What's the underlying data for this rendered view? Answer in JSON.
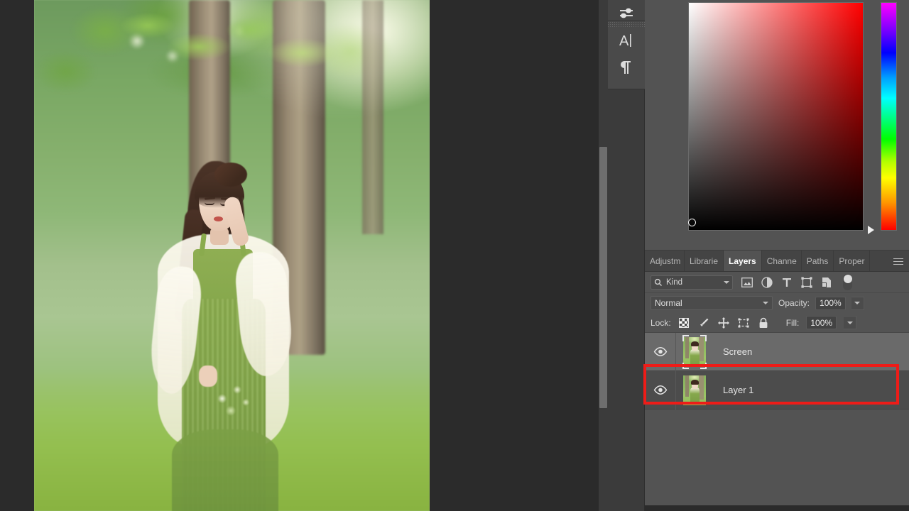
{
  "app": {
    "name": "Adobe Photoshop",
    "canvas_background": "#2b2b2b",
    "panel_background": "#535353"
  },
  "canvas": {
    "document_description": "Photo of a woman in a green dress and white cardigan holding flowers beside a lake with blurred trees and grass",
    "scrollbar": {
      "name": "vertical-scrollbar"
    }
  },
  "icon_dock": {
    "items": [
      {
        "name": "adjustments-icon",
        "label": "Adjustments"
      },
      {
        "name": "character-icon",
        "label": "Character"
      },
      {
        "name": "paragraph-icon",
        "label": "Paragraph"
      }
    ]
  },
  "color_panel": {
    "name": "color-picker",
    "gradient_base_color": "#ff0000",
    "hue_marker_position": "red",
    "sv_cursor_position": "black"
  },
  "panel_tabs": {
    "items": [
      {
        "label": "Adjustm",
        "active": false
      },
      {
        "label": "Librarie",
        "active": false
      },
      {
        "label": "Layers",
        "active": true
      },
      {
        "label": "Channe",
        "active": false
      },
      {
        "label": "Paths",
        "active": false
      },
      {
        "label": "Proper",
        "active": false
      }
    ],
    "menu_icon": "panel-menu-icon"
  },
  "layers_panel": {
    "filter": {
      "search_icon": "search-icon",
      "kind_label": "Kind",
      "icons": [
        {
          "name": "filter-pixel-icon"
        },
        {
          "name": "filter-adjustment-icon"
        },
        {
          "name": "filter-type-icon"
        },
        {
          "name": "filter-shape-icon"
        },
        {
          "name": "filter-smart-object-icon"
        }
      ],
      "toggle": {
        "name": "filter-enable-toggle",
        "state": "on"
      }
    },
    "blend": {
      "mode": "Normal",
      "opacity_label": "Opacity:",
      "opacity_value": "100%"
    },
    "lock": {
      "label": "Lock:",
      "icons": [
        {
          "name": "lock-transparency-icon"
        },
        {
          "name": "lock-image-pixels-icon"
        },
        {
          "name": "lock-position-icon"
        },
        {
          "name": "lock-artboard-nesting-icon"
        },
        {
          "name": "lock-all-icon"
        }
      ],
      "fill_label": "Fill:",
      "fill_value": "100%"
    },
    "layers": [
      {
        "name": "Screen",
        "visible": true,
        "selected": true
      },
      {
        "name": "Layer 1",
        "visible": true,
        "selected": false
      }
    ]
  },
  "annotation": {
    "name": "highlight-box",
    "color": "#ee1c18",
    "target": "Screen layer row"
  }
}
